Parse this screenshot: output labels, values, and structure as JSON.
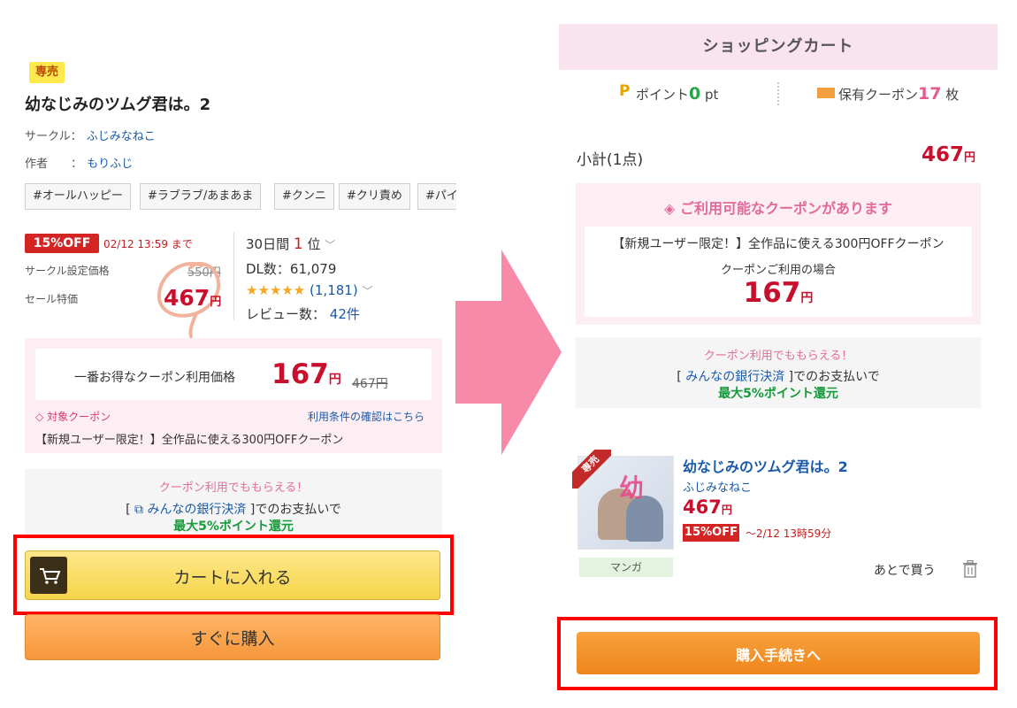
{
  "left": {
    "badge": "専売",
    "title": "幼なじみのツムグ君は。2",
    "circle_label": "サークル：",
    "circle_name": "ふじみなねこ",
    "author_label": "作者　　：",
    "author_name": "もりふじ",
    "tags": [
      "#オールハッピー",
      "#ラブラブ/あまあま",
      "#クンニ",
      "#クリ責め",
      "#パイ"
    ],
    "discount_badge": "15%OFF",
    "deadline": "02/12 13:59 まで",
    "list_price_label": "サークル設定価格",
    "list_price": "550円",
    "sale_price_label": "セール特価",
    "sale_price_num": "467",
    "yen": "円",
    "ranking_prefix": "30日間",
    "ranking_num": "1",
    "ranking_suffix": "位",
    "dl_count": "DL数：61,079",
    "stars": "★★★★★",
    "rating_count": "(1,181)",
    "review_label": "レビュー数：",
    "review_count": "42件",
    "coupon_price_label": "一番お得なクーポン利用価格",
    "coupon_price_num": "167",
    "coupon_price_strike": "467円",
    "target_coupon_label": "対象クーポン",
    "terms_link": "利用条件の確認はこちら",
    "coupon_desc": "【新規ユーザー限定！】全作品に使える300円OFFクーポン",
    "bank_head": "クーポン利用でももらえる！",
    "bank_bracket_open": "[",
    "bank_name": "みんなの銀行決済",
    "bank_after": "]でのお支払いで",
    "bank_reward": "最大5%ポイント還元",
    "add_to_cart": "カートに入れる",
    "buy_now": "すぐに購入"
  },
  "right": {
    "header": "ショッピングカート",
    "points_icon": "P",
    "points_label": "ポイント",
    "points_num": "0",
    "points_unit": "pt",
    "coupon_label": "保有クーポン",
    "coupon_num": "17",
    "coupon_unit": "枚",
    "subtotal_label": "小計(1点)",
    "subtotal_num": "467",
    "yen": "円",
    "coupon_available": "ご利用可能なクーポンがあります",
    "coupon_desc": "【新規ユーザー限定！】全作品に使える300円OFFクーポン",
    "coupon_use_label": "クーポンご利用の場合",
    "coupon_price_num": "167",
    "bank_head": "クーポン利用でももらえる！",
    "bank_bracket_open": "[",
    "bank_name": "みんなの銀行決済",
    "bank_after": "]でのお支払いで",
    "bank_reward": "最大5%ポイント還元",
    "product_badge": "専売",
    "product_cover_text": "幼",
    "product_title": "幼なじみのツムグ君は。2",
    "product_circle": "ふじみなねこ",
    "product_price_num": "467",
    "product_off": "15%OFF",
    "product_deadline": "～2/12 13時59分",
    "category_tag": "マンガ",
    "later_button": "あとで買う",
    "checkout_button": "購入手続きへ"
  },
  "colors": {
    "price_red": "#c8102e",
    "link_blue": "#1a5aa8",
    "coupon_pink": "#fdeef3",
    "accent_pink": "#e06a9a",
    "bonus_green": "#179a3c",
    "cart_yellow": "#f5d44a",
    "checkout_orange": "#ee871c",
    "highlight_red": "#ff0000",
    "arrow_pink": "#f78aa8"
  },
  "icons": [
    "cart-icon",
    "coupon-tag-icon",
    "external-link-icon",
    "chevron-down-icon",
    "ticket-icon",
    "trash-icon"
  ]
}
